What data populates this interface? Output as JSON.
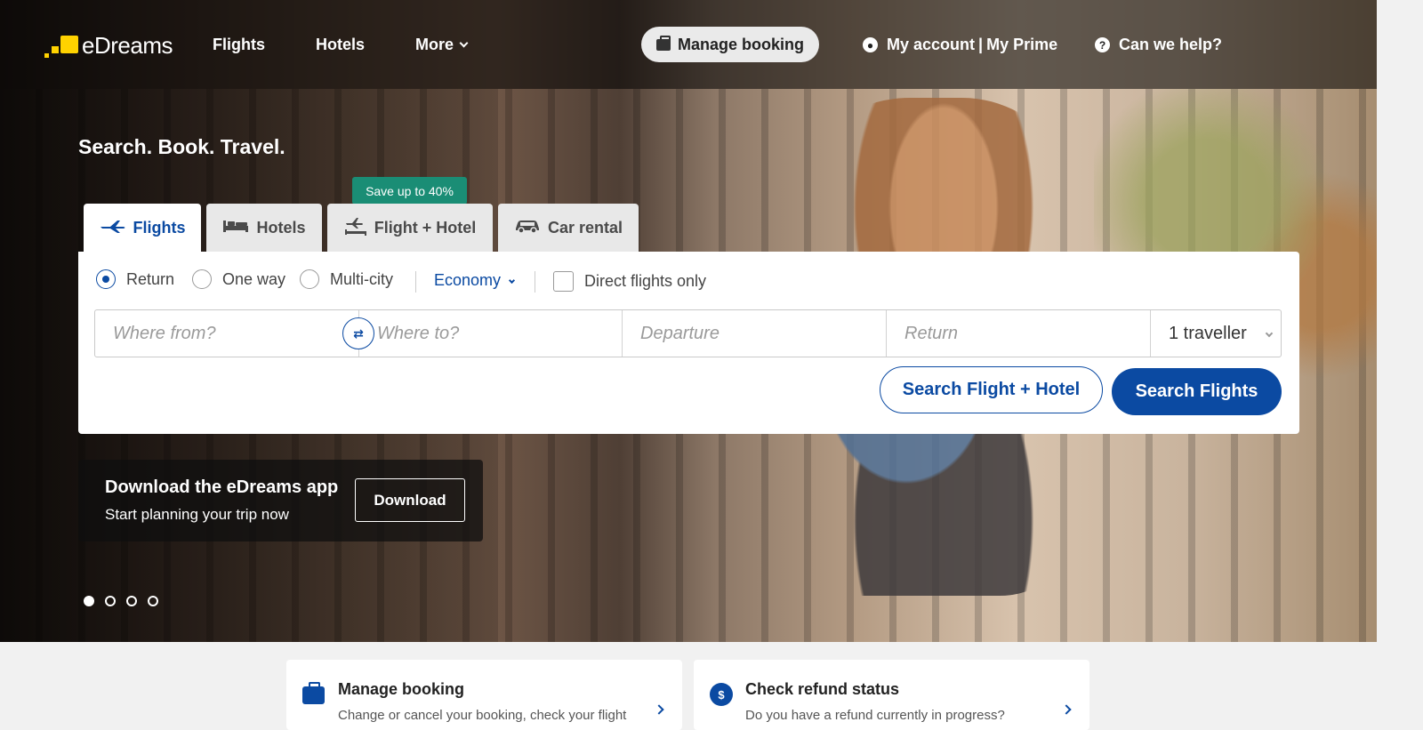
{
  "header": {
    "logo": "eDreams",
    "nav": [
      "Flights",
      "Hotels",
      "More"
    ],
    "manage_booking": "Manage booking",
    "my_account": "My account",
    "my_prime": "My Prime",
    "help": "Can we help?"
  },
  "hero": {
    "tagline": "Search. Book. Travel."
  },
  "tabs": {
    "flights": "Flights",
    "hotels": "Hotels",
    "flight_hotel": "Flight + Hotel",
    "car_rental": "Car rental",
    "badge": "Save up to 40%"
  },
  "search": {
    "trip_types": [
      "Return",
      "One way",
      "Multi-city"
    ],
    "selected_trip_type": "Return",
    "cabin": "Economy",
    "direct_only": "Direct flights only",
    "from_placeholder": "Where from?",
    "to_placeholder": "Where to?",
    "departure_placeholder": "Departure",
    "return_placeholder": "Return",
    "travellers": "1 traveller",
    "btn_flight_hotel": "Search Flight + Hotel",
    "btn_flights": "Search Flights"
  },
  "promo": {
    "title": "Download the eDreams app",
    "subtitle": "Start planning your trip now",
    "button": "Download"
  },
  "carousel": {
    "count": 4,
    "active": 1
  },
  "cards": [
    {
      "title": "Manage booking",
      "subtitle": "Change or cancel your booking, check your flight"
    },
    {
      "title": "Check refund status",
      "subtitle": "Do you have a refund currently in progress?"
    }
  ],
  "colors": {
    "brand_blue": "#0b4aa2",
    "logo_yellow": "#ffd200",
    "badge_green": "#1a8d75"
  }
}
